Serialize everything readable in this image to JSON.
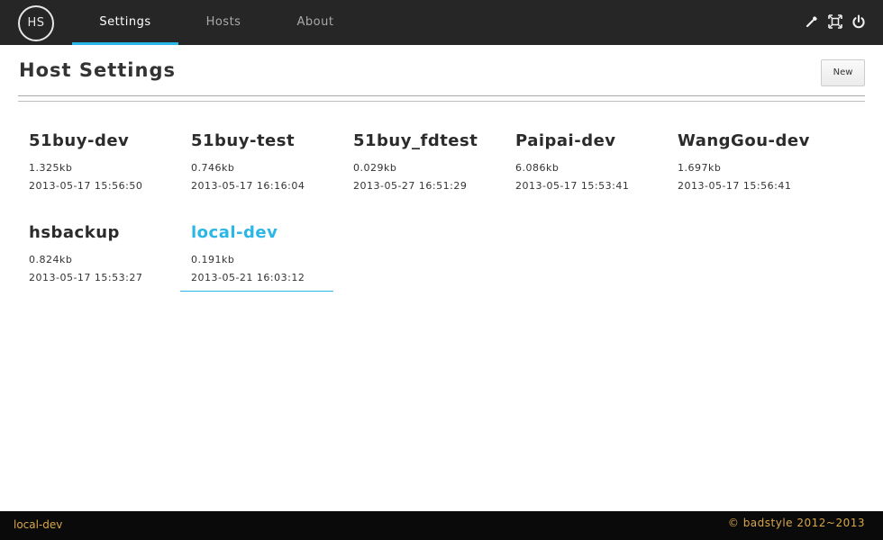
{
  "header": {
    "logo_text": "HS",
    "tabs": [
      {
        "label": "Settings",
        "active": true
      },
      {
        "label": "Hosts",
        "active": false
      },
      {
        "label": "About",
        "active": false
      }
    ],
    "icons": [
      "wrench-icon",
      "fullscreen-icon",
      "power-icon"
    ],
    "accent_color": "#2bb6e8"
  },
  "main": {
    "title": "Host Settings",
    "new_label": "New",
    "hosts": [
      {
        "name": "51buy-dev",
        "size": "1.325kb",
        "date": "2013-05-17 15:56:50"
      },
      {
        "name": "51buy-test",
        "size": "0.746kb",
        "date": "2013-05-17 16:16:04"
      },
      {
        "name": "51buy_fdtest",
        "size": "0.029kb",
        "date": "2013-05-27 16:51:29"
      },
      {
        "name": "Paipai-dev",
        "size": "6.086kb",
        "date": "2013-05-17 15:53:41"
      },
      {
        "name": "WangGou-dev",
        "size": "1.697kb",
        "date": "2013-05-17 15:56:41"
      },
      {
        "name": "hsbackup",
        "size": "0.824kb",
        "date": "2013-05-17 15:53:27"
      },
      {
        "name": "local-dev",
        "size": "0.191kb",
        "date": "2013-05-21 16:03:12",
        "active": true
      }
    ]
  },
  "footer": {
    "current_host": "local-dev",
    "copyright": "© badstyle 2012~2013"
  }
}
